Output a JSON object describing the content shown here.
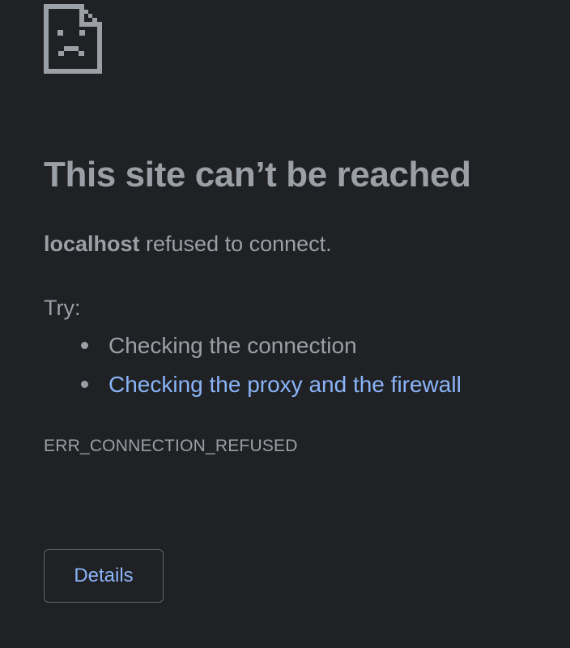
{
  "error_page": {
    "icon": "sad-page-icon",
    "title": "This site can’t be reached",
    "host": "localhost",
    "message": " refused to connect.",
    "try_label": "Try:",
    "suggestions": [
      {
        "label": "Checking the connection",
        "is_link": false
      },
      {
        "label": "Checking the proxy and the firewall",
        "is_link": true
      }
    ],
    "error_code": "ERR_CONNECTION_REFUSED",
    "details_button_label": "Details"
  },
  "colors": {
    "background": "#202124",
    "text": "#9aa0a6",
    "link": "#8ab4f8",
    "button_border": "#5f6368"
  }
}
